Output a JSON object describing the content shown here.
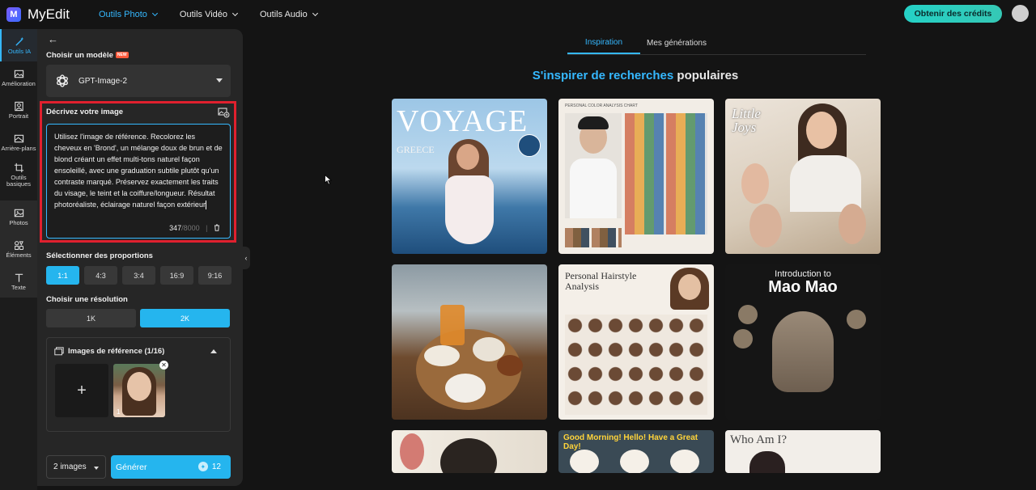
{
  "app": {
    "name": "MyEdit",
    "logo_letter": "M"
  },
  "topnav": [
    {
      "label": "Outils Photo",
      "active": true
    },
    {
      "label": "Outils Vidéo",
      "active": false
    },
    {
      "label": "Outils Audio",
      "active": false
    }
  ],
  "header": {
    "credits_button": "Obtenir des crédits"
  },
  "leftbar": [
    {
      "label": "Outils IA",
      "icon": "magic-wand-icon",
      "active": true
    },
    {
      "label": "Amélioration",
      "icon": "image-enhance-icon"
    },
    {
      "label": "Portrait",
      "icon": "portrait-icon"
    },
    {
      "label": "Arrière-plans",
      "icon": "background-icon"
    },
    {
      "label": "Outils basiques",
      "icon": "crop-icon"
    },
    {
      "label": "Photos",
      "icon": "photos-icon"
    },
    {
      "label": "Éléments",
      "icon": "elements-icon"
    },
    {
      "label": "Texte",
      "icon": "text-icon"
    }
  ],
  "panel": {
    "model_label": "Choisir un modèle",
    "new_badge": "NEW",
    "model_value": "GPT-Image-2",
    "prompt_label": "Décrivez votre image",
    "prompt_text": "Utilisez l'image de référence. Recolorez les cheveux en 'Brond', un mélange doux de brun et de blond créant un effet multi-tons naturel façon ensoleillé, avec une graduation subtile plutôt qu'un contraste marqué. Préservez exactement les traits du visage, le teint et la coiffure/longueur. Résultat photoréaliste, éclairage naturel façon extérieur",
    "prompt_count": "347",
    "prompt_max": "/8000",
    "ratio_label": "Sélectionner des proportions",
    "ratios": [
      "1:1",
      "4:3",
      "3:4",
      "16:9",
      "9:16"
    ],
    "ratio_selected": "1:1",
    "resolution_label": "Choisir une résolution",
    "resolutions": [
      "1K",
      "2K"
    ],
    "resolution_selected": "2K",
    "reference_title": "Images de référence (1/16)",
    "reference_add": "+",
    "reference_index": "1",
    "image_count": "2 images",
    "generate_label": "Générer",
    "generate_cost": "12"
  },
  "main": {
    "tabs": [
      {
        "label": "Inspiration",
        "active": true
      },
      {
        "label": "Mes générations",
        "active": false
      }
    ],
    "heading_highlight": "S'inspirer de recherches",
    "heading_rest": " populaires",
    "cards": [
      {
        "title": "VOYAGE",
        "subtitle": "GREECE"
      },
      {
        "title": "PERSONAL COLOR ANALYSIS CHART"
      },
      {
        "title": "Little Joys"
      },
      {
        "title": ""
      },
      {
        "title": "Personal Hairstyle Analysis"
      },
      {
        "title": "Introduction to",
        "subtitle": "Mao Mao"
      },
      {
        "title": ""
      },
      {
        "title": "Good Morning! Hello! Have a Great Day!"
      },
      {
        "title": "Who Am I?"
      }
    ]
  }
}
